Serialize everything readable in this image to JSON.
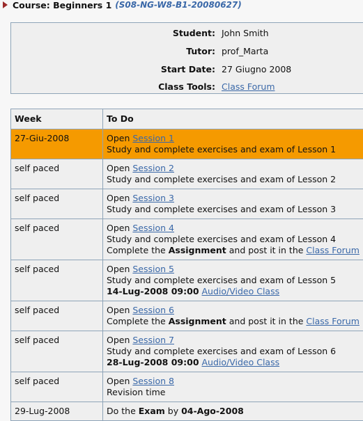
{
  "course": {
    "label": "Course: Beginners 1",
    "code": "(S08-NG-W8-B1-20080627)"
  },
  "info": {
    "student_label": "Student:",
    "student_value": "John Smith",
    "tutor_label": "Tutor:",
    "tutor_value": "prof_Marta",
    "start_label": "Start Date:",
    "start_value": "27 Giugno 2008",
    "tools_label": "Class Tools:",
    "tools_link": "Class Forum"
  },
  "colors": {
    "current_row": "#f59a00",
    "link": "#3a68a8",
    "border": "#8ea4b8"
  },
  "table": {
    "headers": {
      "week": "Week",
      "todo": "To Do"
    },
    "common": {
      "open": "Open ",
      "complete_pre": "Complete the ",
      "assignment": "Assignment",
      "complete_post": " and post it in the ",
      "class_forum": "Class Forum",
      "av_class": "Audio/Video Class"
    },
    "rows": [
      {
        "week": "27-Giu-2008",
        "session": "Session 1",
        "study": "Study and complete exercises and exam of Lesson 1"
      },
      {
        "week": "self paced",
        "session": "Session 2",
        "study": "Study and complete exercises and exam of Lesson 2"
      },
      {
        "week": "self paced",
        "session": "Session 3",
        "study": "Study and complete exercises and exam of Lesson 3"
      },
      {
        "week": "self paced",
        "session": "Session 4",
        "study": "Study and complete exercises and exam of Lesson 4"
      },
      {
        "week": "self paced",
        "session": "Session 5",
        "study": "Study and complete exercises and exam of Lesson 5",
        "datetime": "14-Lug-2008 09:00"
      },
      {
        "week": "self paced",
        "session": "Session 6"
      },
      {
        "week": "self paced",
        "session": "Session 7",
        "study": "Study and complete exercises and exam of Lesson 6",
        "datetime": "28-Lug-2008 09:00"
      },
      {
        "week": "self paced",
        "session": "Session 8",
        "study": "Revision time"
      },
      {
        "week": "29-Lug-2008",
        "exam_pre": "Do the ",
        "exam_word": "Exam",
        "exam_mid": " by ",
        "exam_date": "04-Ago-2008"
      }
    ]
  }
}
